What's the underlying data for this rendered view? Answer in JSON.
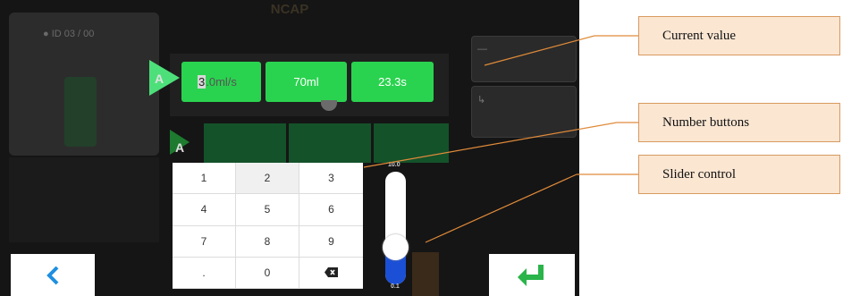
{
  "screen": {
    "title": "NCAP",
    "left_panel_text": "● ID 03 / 00",
    "phase_markers": [
      "A",
      "A"
    ],
    "fields": {
      "flow_rate_cursor": "3",
      "flow_rate_rest": ".0ml/s",
      "volume": "70ml",
      "duration": "23.3s"
    }
  },
  "keypad": {
    "keys": [
      "1",
      "2",
      "3",
      "4",
      "5",
      "6",
      "7",
      "8",
      "9",
      ".",
      "0",
      "backspace"
    ]
  },
  "slider": {
    "max_label": "10.0",
    "min_label": "0.1",
    "level_fraction": 0.22
  },
  "nav": {
    "back_icon": "chevron-left-icon",
    "enter_icon": "enter-return-icon"
  },
  "annotations": {
    "current_value": "Current value",
    "number_buttons": "Number buttons",
    "slider_control": "Slider control"
  },
  "colors": {
    "field_green": "#2ad34f",
    "slider_blue": "#1a4fd6",
    "enter_green": "#2ab44a",
    "back_blue": "#1e8fe0",
    "callout_fill": "#fbe6d2",
    "callout_line": "#e08a3a"
  }
}
